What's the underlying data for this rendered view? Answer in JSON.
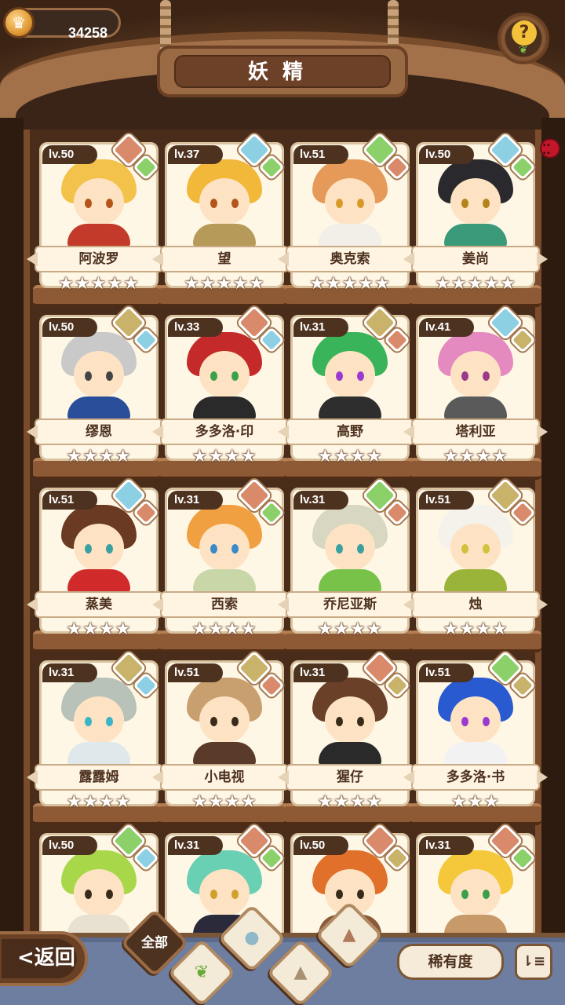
{
  "header": {
    "coins": "34258",
    "title": "妖精",
    "help_icon": "lightbulb-sprout-icon"
  },
  "fairies": [
    {
      "level": "lv.50",
      "name": "阿波罗",
      "stars": "★★★★★",
      "main": "fire",
      "sub": "grass",
      "hair": "#f3c24a",
      "outfit": "#c43a2a",
      "eye": "#b4541a"
    },
    {
      "level": "lv.37",
      "name": "望",
      "stars": "★★★★★",
      "main": "water",
      "sub": "grass",
      "hair": "#f1b83a",
      "outfit": "#b59a5a",
      "eye": "#b4541a"
    },
    {
      "level": "lv.51",
      "name": "奥克索",
      "stars": "★★★★★",
      "main": "grass",
      "sub": "fire",
      "hair": "#e59a5a",
      "outfit": "#f2efe8",
      "eye": "#d79a2a"
    },
    {
      "level": "lv.50",
      "name": "姜尚",
      "stars": "★★★★★",
      "main": "water",
      "sub": "grass",
      "hair": "#2a2a2e",
      "outfit": "#3b9a7a",
      "eye": "#b4841a"
    },
    {
      "level": "lv.50",
      "name": "缪恩",
      "stars": "★★★★",
      "main": "earth",
      "sub": "water",
      "hair": "#c9c9c9",
      "outfit": "#2b4e9a",
      "eye": "#444444"
    },
    {
      "level": "lv.33",
      "name": "多多洛·印",
      "stars": "★★★★",
      "main": "fire",
      "sub": "water",
      "hair": "#c42a2a",
      "outfit": "#2a2a2a",
      "eye": "#3aa04a"
    },
    {
      "level": "lv.31",
      "name": "高野",
      "stars": "★★★★",
      "main": "earth",
      "sub": "fire",
      "hair": "#3ab45a",
      "outfit": "#2e2e2e",
      "eye": "#9a3ad0"
    },
    {
      "level": "lv.41",
      "name": "塔利亚",
      "stars": "★★★★",
      "main": "water",
      "sub": "earth",
      "hair": "#e48ac0",
      "outfit": "#5a5a5a",
      "eye": "#9a3a8a"
    },
    {
      "level": "lv.51",
      "name": "蒸美",
      "stars": "★★★★",
      "main": "water",
      "sub": "fire",
      "hair": "#6a3a22",
      "outfit": "#d02a2a",
      "eye": "#3aa0a0"
    },
    {
      "level": "lv.31",
      "name": "西索",
      "stars": "★★★★",
      "main": "fire",
      "sub": "grass",
      "hair": "#f0a040",
      "outfit": "#c9d7a8",
      "eye": "#3a8ac8"
    },
    {
      "level": "lv.31",
      "name": "乔尼亚斯",
      "stars": "★★★★",
      "main": "grass",
      "sub": "fire",
      "hair": "#d8d8c2",
      "outfit": "#78c24a",
      "eye": "#3aa0a0"
    },
    {
      "level": "lv.51",
      "name": "烛",
      "stars": "★★★★",
      "main": "earth",
      "sub": "fire",
      "hair": "#f4f2ea",
      "outfit": "#9ab43a",
      "eye": "#d0c23a"
    },
    {
      "level": "lv.31",
      "name": "露露姆",
      "stars": "★★★★",
      "main": "earth",
      "sub": "water",
      "hair": "#b8c2b8",
      "outfit": "#dfe8ea",
      "eye": "#3ab4c8"
    },
    {
      "level": "lv.51",
      "name": "小电视",
      "stars": "★★★★",
      "main": "earth",
      "sub": "fire",
      "hair": "#c8a070",
      "outfit": "#5a3a28",
      "eye": "#3a2a1a"
    },
    {
      "level": "lv.31",
      "name": "猩仔",
      "stars": "★★★★",
      "main": "fire",
      "sub": "earth",
      "hair": "#6a4028",
      "outfit": "#2a2a2a",
      "eye": "#3a2a1a"
    },
    {
      "level": "lv.51",
      "name": "多多洛·书",
      "stars": "★★★",
      "main": "grass",
      "sub": "earth",
      "hair": "#2a5ad0",
      "outfit": "#f2f2f2",
      "eye": "#9a3ad0"
    },
    {
      "level": "lv.50",
      "name": "",
      "stars": "",
      "main": "grass",
      "sub": "water",
      "hair": "#a8d84a",
      "outfit": "#e8e0d0",
      "eye": "#3a2a1a"
    },
    {
      "level": "lv.31",
      "name": "",
      "stars": "",
      "main": "fire",
      "sub": "grass",
      "hair": "#6ad0b4",
      "outfit": "#2a2a3a",
      "eye": "#d0a02a"
    },
    {
      "level": "lv.50",
      "name": "",
      "stars": "",
      "main": "fire",
      "sub": "earth",
      "hair": "#e0702a",
      "outfit": "#8a5a3a",
      "eye": "#3a2a1a"
    },
    {
      "level": "lv.31",
      "name": "",
      "stars": "",
      "main": "fire",
      "sub": "grass",
      "hair": "#f4c83a",
      "outfit": "#c89a6a",
      "eye": "#3aa04a"
    }
  ],
  "footer": {
    "back_label": "<返回",
    "filter_all": "全部",
    "filter_icons": [
      "sprout-icon",
      "water-drop-icon",
      "mountain-icon",
      "volcano-icon"
    ],
    "rarity_label": "稀有度",
    "sort_icon": "sort-icon",
    "sort_glyph": "⇂≡"
  },
  "colors": {
    "fire": "#d88a6a",
    "water": "#8dd0e3",
    "grass": "#8cd06a",
    "earth": "#c9b26a"
  }
}
